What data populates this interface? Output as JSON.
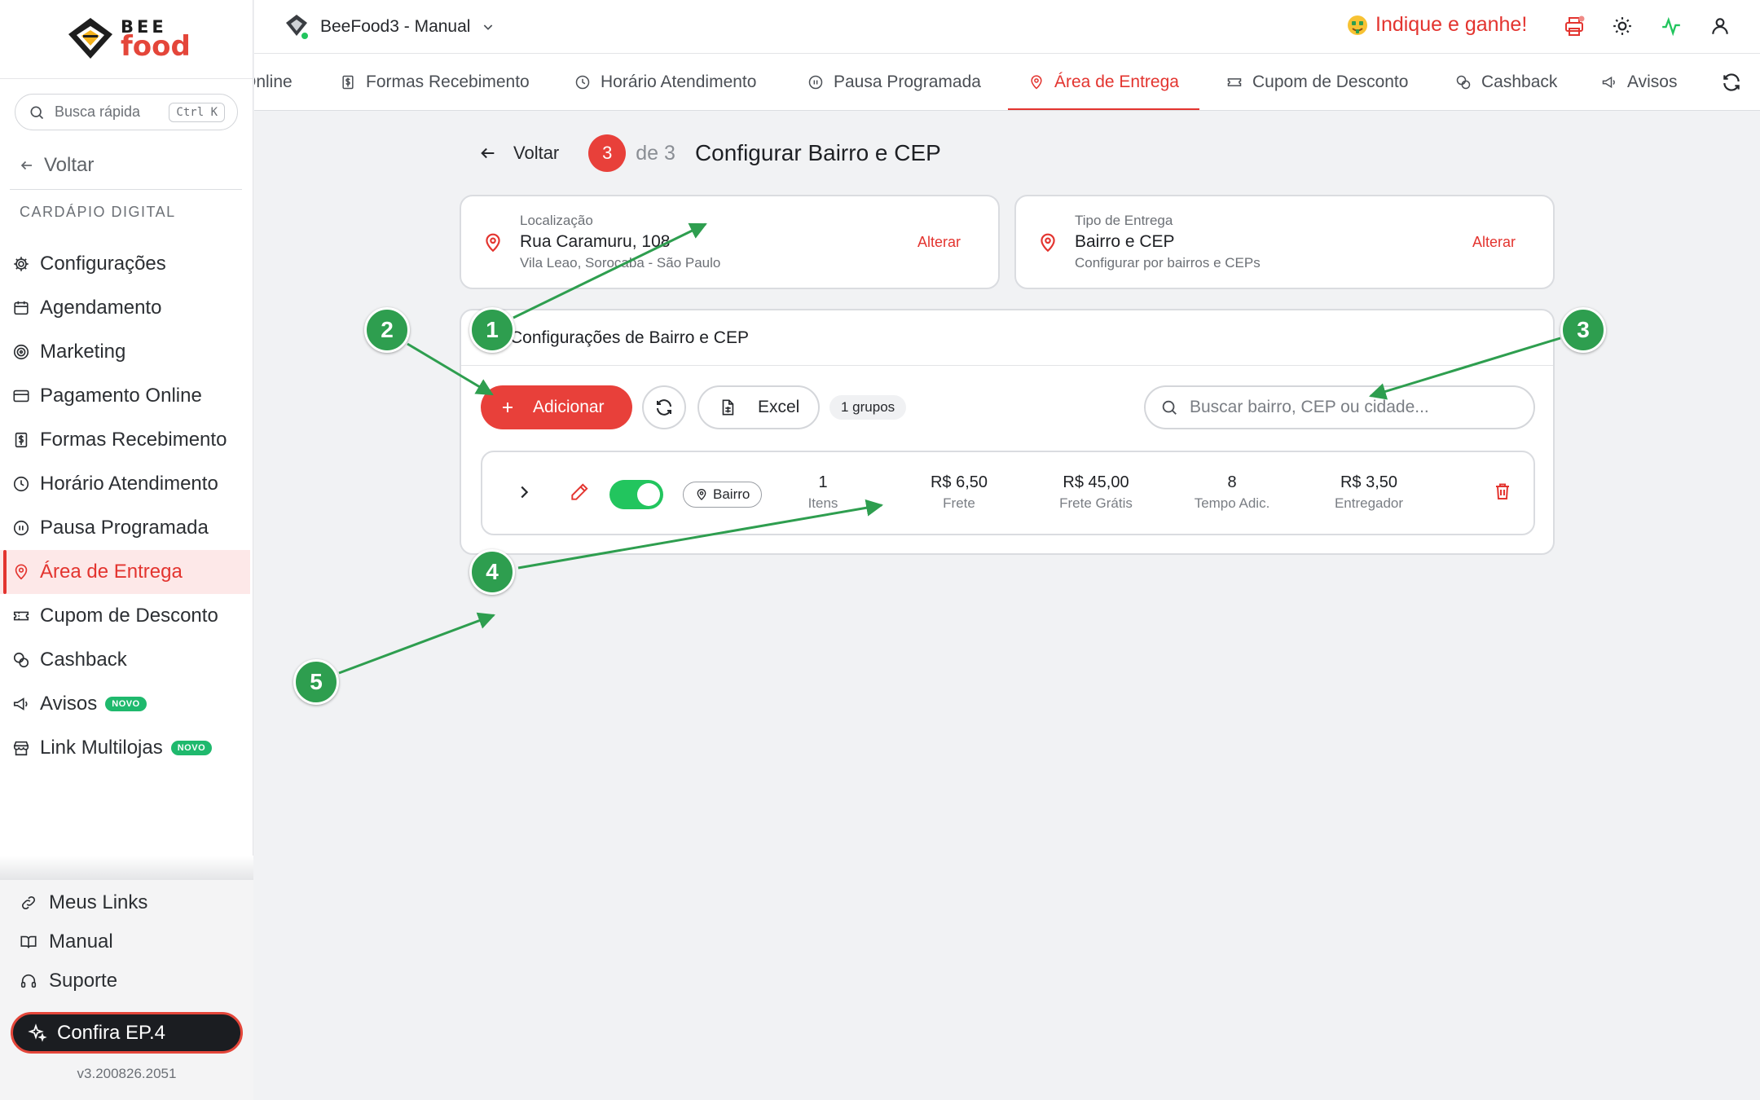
{
  "brand": {
    "line1": "BEE",
    "line2": "food"
  },
  "sidebar": {
    "search_placeholder": "Busca rápida",
    "search_shortcut": "Ctrl K",
    "back_label": "Voltar",
    "section_title": "CARDÁPIO DIGITAL",
    "items": [
      {
        "label": "Configurações",
        "icon": "gear-icon"
      },
      {
        "label": "Agendamento",
        "icon": "calendar-icon"
      },
      {
        "label": "Marketing",
        "icon": "target-icon"
      },
      {
        "label": "Pagamento Online",
        "icon": "credit-card-icon"
      },
      {
        "label": "Formas Recebimento",
        "icon": "receipt-icon"
      },
      {
        "label": "Horário Atendimento",
        "icon": "clock-icon"
      },
      {
        "label": "Pausa Programada",
        "icon": "pause-circle-icon"
      },
      {
        "label": "Área de Entrega",
        "icon": "map-pin-icon",
        "active": true
      },
      {
        "label": "Cupom de Desconto",
        "icon": "ticket-icon"
      },
      {
        "label": "Cashback",
        "icon": "coins-icon"
      },
      {
        "label": "Avisos",
        "icon": "megaphone-icon",
        "badge": "NOVO"
      },
      {
        "label": "Link Multilojas",
        "icon": "store-icon",
        "badge": "NOVO"
      }
    ],
    "bottom": [
      {
        "label": "Meus Links",
        "icon": "link-icon"
      },
      {
        "label": "Manual",
        "icon": "book-icon"
      },
      {
        "label": "Suporte",
        "icon": "headset-icon"
      }
    ],
    "cta_label": "Confira EP.4",
    "version": "v3.200826.2051"
  },
  "topbar": {
    "store_name": "BeeFood3 - Manual",
    "refer_label": "Indique e ganhe!"
  },
  "tabs": [
    {
      "label": "Online",
      "icon": "none"
    },
    {
      "label": "Formas Recebimento",
      "icon": "receipt-icon"
    },
    {
      "label": "Horário Atendimento",
      "icon": "clock-icon"
    },
    {
      "label": "Pausa Programada",
      "icon": "pause-circle-icon"
    },
    {
      "label": "Área de Entrega",
      "icon": "map-pin-icon",
      "active": true
    },
    {
      "label": "Cupom de Desconto",
      "icon": "ticket-icon"
    },
    {
      "label": "Cashback",
      "icon": "coins-icon"
    },
    {
      "label": "Avisos",
      "icon": "megaphone-icon"
    }
  ],
  "wizard": {
    "back_label": "Voltar",
    "step": "3",
    "step_of": "de 3",
    "title": "Configurar Bairro e CEP"
  },
  "location_card": {
    "label": "Localização",
    "value": "Rua Caramuru, 108",
    "sub": "Vila Leao, Sorocaba - São Paulo",
    "action": "Alterar"
  },
  "delivery_card": {
    "label": "Tipo de Entrega",
    "value": "Bairro e CEP",
    "sub": "Configurar por bairros e CEPs",
    "action": "Alterar"
  },
  "panel": {
    "title": "Configurações de Bairro e CEP",
    "add_label": "Adicionar",
    "excel_label": "Excel",
    "groups_count": "1 grupos",
    "search_placeholder": "Buscar bairro, CEP ou cidade..."
  },
  "row": {
    "type_chip": "Bairro",
    "enabled": true,
    "stats": [
      {
        "value": "1",
        "label": "Itens"
      },
      {
        "value": "R$ 6,50",
        "label": "Frete"
      },
      {
        "value": "R$ 45,00",
        "label": "Frete Grátis"
      },
      {
        "value": "8",
        "label": "Tempo Adic."
      },
      {
        "value": "R$ 3,50",
        "label": "Entregador"
      }
    ]
  },
  "markers": [
    "1",
    "2",
    "3",
    "4",
    "5"
  ],
  "colors": {
    "accent": "#e8403a",
    "success": "#22c55e",
    "marker": "#2e9e4f"
  }
}
